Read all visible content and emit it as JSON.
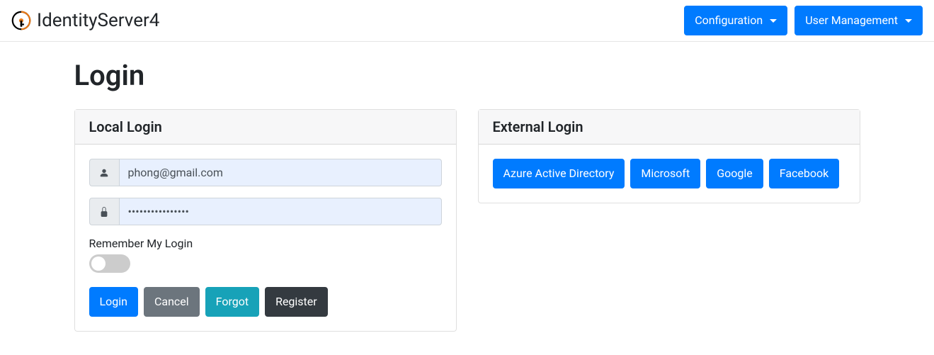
{
  "navbar": {
    "brand": "IdentityServer4",
    "nav": {
      "configuration": "Configuration",
      "user_management": "User Management"
    }
  },
  "page": {
    "title": "Login"
  },
  "local_login": {
    "header": "Local Login",
    "username_value": "phong@gmail.com",
    "password_value": "••••••••••••••••",
    "remember_label": "Remember My Login",
    "login_button": "Login",
    "cancel_button": "Cancel",
    "forgot_button": "Forgot",
    "register_button": "Register"
  },
  "external_login": {
    "header": "External Login",
    "providers": {
      "azure": "Azure Active Directory",
      "microsoft": "Microsoft",
      "google": "Google",
      "facebook": "Facebook"
    }
  }
}
